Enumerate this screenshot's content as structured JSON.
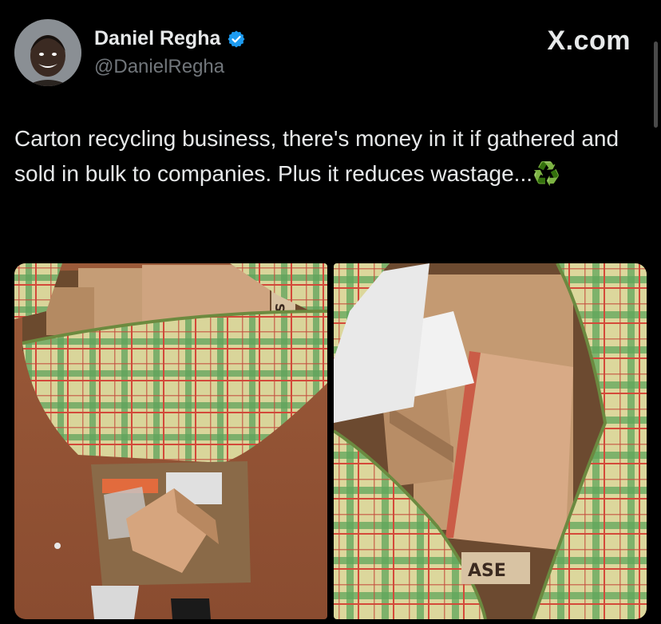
{
  "author": {
    "display_name": "Daniel Regha",
    "handle": "@DanielRegha",
    "verified": true
  },
  "brand": "X.com",
  "tweet": {
    "text": "Carton recycling business, there's money in it if gathered and sold in bulk to companies. Plus it reduces wastage...",
    "emoji": "♻️"
  },
  "media": [
    {
      "kind": "photo",
      "box_label": "SE"
    },
    {
      "kind": "photo",
      "box_label": "ASE"
    }
  ],
  "colors": {
    "background": "#000000",
    "text_primary": "#e7e9ea",
    "text_secondary": "#71767b",
    "verified_blue": "#1d9bf0",
    "recycle_green": "#18a44a"
  },
  "icons": {
    "verified": "verified-badge-icon",
    "recycle": "recycle-icon"
  }
}
